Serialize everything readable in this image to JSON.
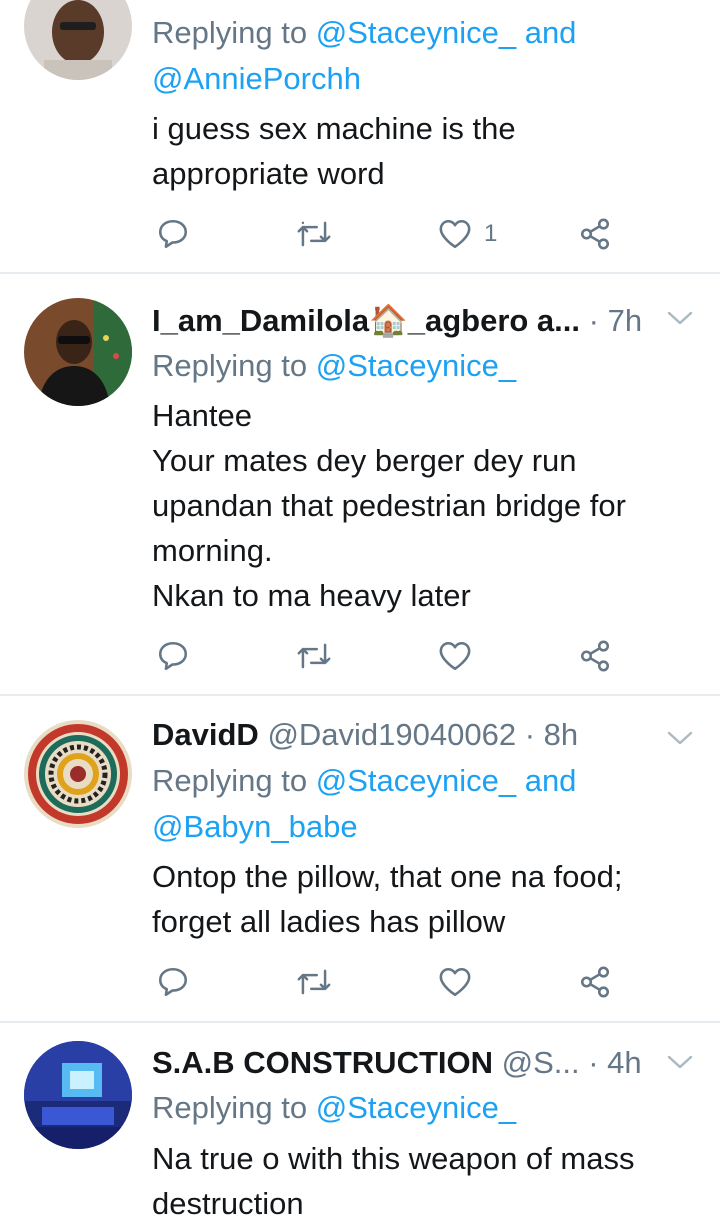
{
  "tweets": [
    {
      "reply_prefix": "Replying to",
      "reply_line1_handle": "@Staceynice_",
      "reply_line1_and": "and",
      "reply_line2_handle": "@AnniePorchh",
      "text_lines": [
        "i guess sex machine is the",
        "appropriate word"
      ],
      "like_count": "1"
    },
    {
      "name": "I_am_Damilola",
      "name_emoji": "🏠",
      "name_suffix": "_agbero a...",
      "time": "· 7h",
      "reply_prefix": "Replying to",
      "reply_handle": "@Staceynice_",
      "text_lines": [
        "Hantee",
        "Your mates dey berger dey run",
        "upandan that pedestrian bridge for",
        "morning.",
        "Nkan to ma heavy later"
      ]
    },
    {
      "name": "DavidD",
      "handle": "@David19040062",
      "time": "· 8h",
      "reply_prefix": "Replying to",
      "reply_line1_handle": "@Staceynice_",
      "reply_line1_and": "and",
      "reply_line2_handle": "@Babyn_babe",
      "text_lines": [
        "Ontop the pillow, that one na food;",
        "forget all ladies has pillow"
      ]
    },
    {
      "name": "S.A.B CONSTRUCTION",
      "handle": "@S...",
      "time": "· 4h",
      "reply_prefix": "Replying to",
      "reply_handle": "@Staceynice_",
      "text_lines": [
        "Na true o with this weapon of mass",
        "destruction"
      ]
    }
  ],
  "icons": {
    "reply": "reply-icon",
    "retweet": "retweet-icon",
    "like": "heart-icon",
    "share": "share-icon",
    "more": "chevron-down-icon"
  },
  "colors": {
    "mention": "#1da1f2",
    "secondary": "#657786",
    "divider": "#e6ecf0"
  }
}
